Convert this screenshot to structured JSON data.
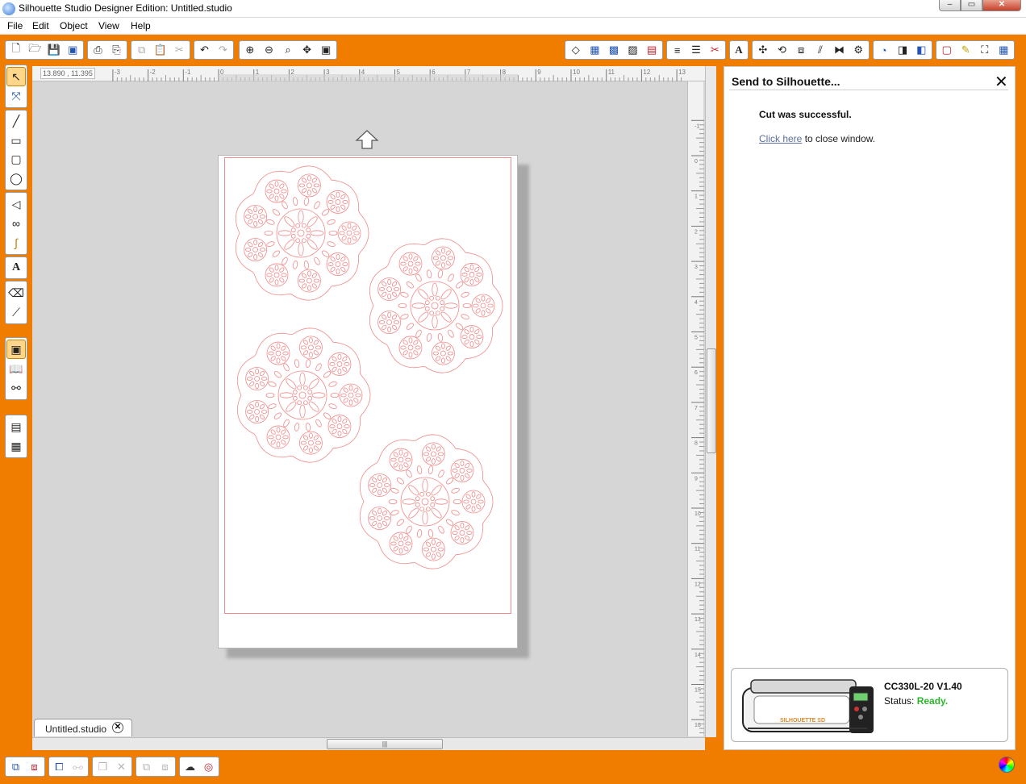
{
  "window": {
    "title": "Silhouette Studio Designer Edition: Untitled.studio",
    "minimize": "‒",
    "maximize": "▭",
    "close": "✕"
  },
  "menu": {
    "items": [
      "File",
      "Edit",
      "Object",
      "View",
      "Help"
    ]
  },
  "ruler": {
    "coordinates": "13.890 , 11.395"
  },
  "document_tab": {
    "label": "Untitled.studio",
    "close": "✕"
  },
  "panel": {
    "title": "Send to Silhouette...",
    "close": "✕",
    "message": "Cut was successful.",
    "close_link": "Click here",
    "close_suffix": " to close window.",
    "device": {
      "model": "CC330L-20 V1.40",
      "status_label": "Status: ",
      "status_value": "Ready.",
      "status_color": "#2bb52b",
      "brand": "SILHOUETTE SD"
    }
  },
  "colors": {
    "accent": "#f07d00",
    "cut_line": "#f08a8a"
  }
}
